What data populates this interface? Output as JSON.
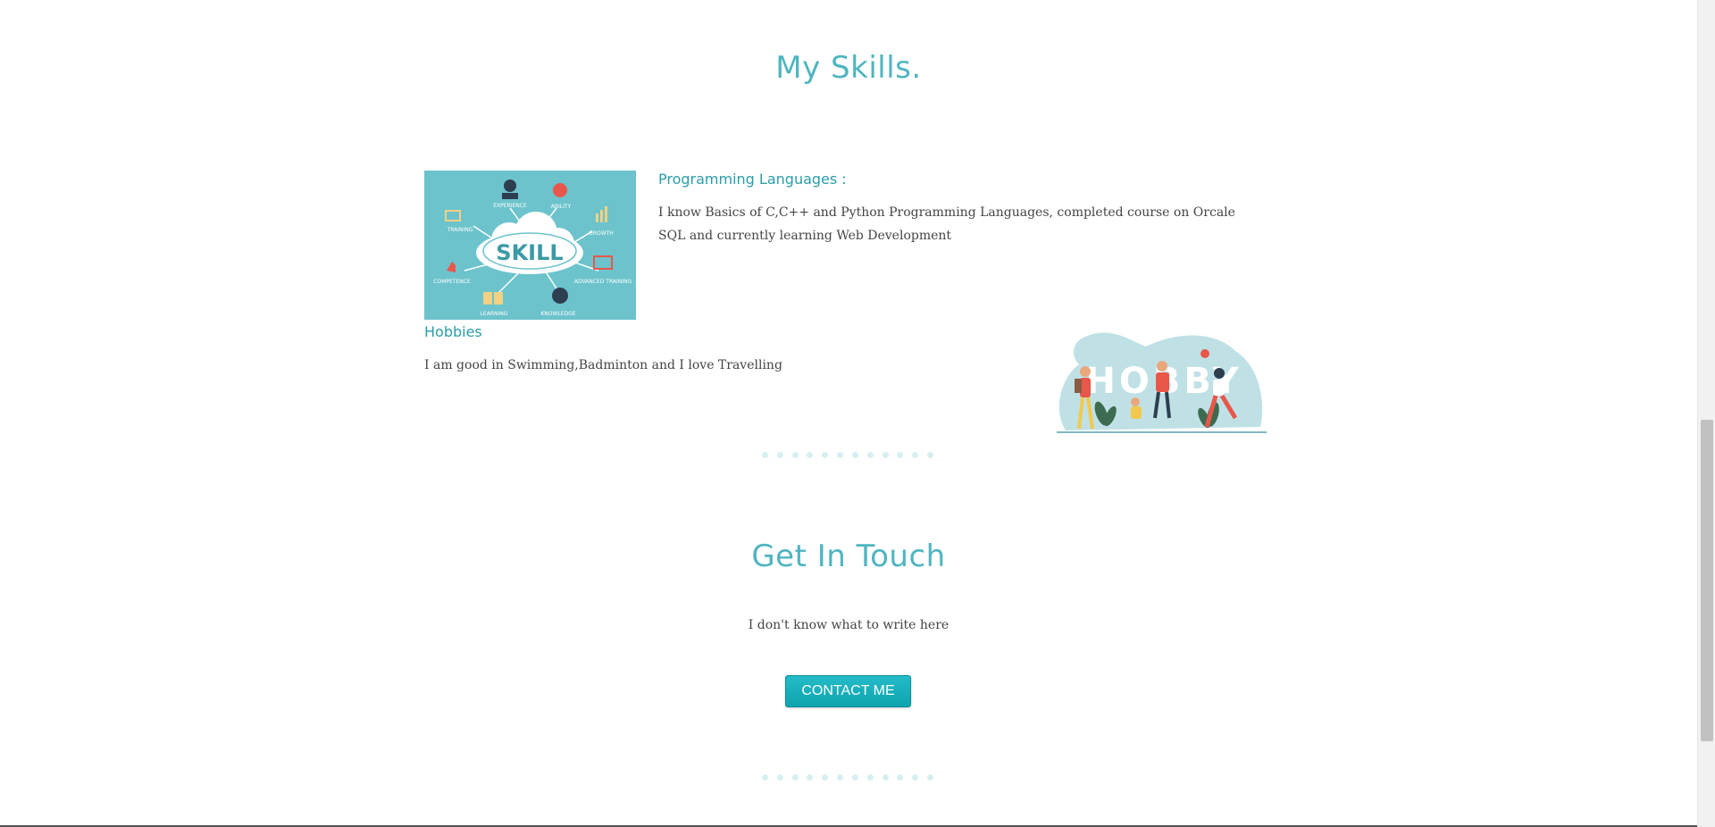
{
  "skills": {
    "title": "My Skills.",
    "skill_image": {
      "center_text": "SKILL",
      "labels": [
        "EXPERIENCE",
        "ABILITY",
        "TRAINING",
        "GROWTH",
        "COMPETENCE",
        "ADVANCED TRAINING",
        "LEARNING",
        "KNOWLEDGE"
      ]
    },
    "programming": {
      "heading": "Programming Languages :",
      "text": "I know Basics of C,C++ and Python Programming Languages, completed course on Orcale SQL and currently learning Web Development"
    },
    "hobbies": {
      "heading": "Hobbies",
      "text": "I am good in Swimming,Badminton and I love Travelling",
      "image_text": "HOBBY"
    }
  },
  "contact": {
    "title": "Get In Touch",
    "text": "I don't know what to write here",
    "button_label": "CONTACT ME"
  },
  "colors": {
    "accent": "#4fb5c0",
    "heading": "#2a9da8",
    "button": "#13aab5",
    "dots": "#d8eff2"
  }
}
